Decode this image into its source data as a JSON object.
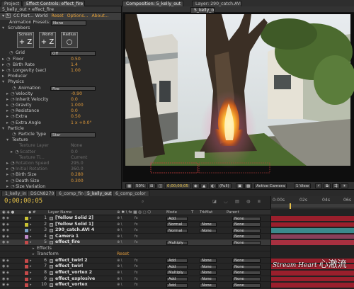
{
  "top_tabs": {
    "project": "Project",
    "effect_controls": "Effect Controls: effect_fire",
    "composition": "Composition: 5_kelly_out",
    "layer": "Layer: 290_catch.AVI 4"
  },
  "effect_controls": {
    "subtitle": "5_kelly_out • effect_fire",
    "effect_name": "CC Part... World",
    "reset": "Reset",
    "options": "Options...",
    "about": "About...",
    "presets_label": "Animation Presets:",
    "presets_value": "None",
    "scrubbers_label": "Scrubbers",
    "scrub": [
      {
        "label": "Screen",
        "glyph": "+ Z"
      },
      {
        "label": "World",
        "glyph": "+ Z"
      },
      {
        "label": "Radius",
        "glyph": "○"
      }
    ],
    "grid_label": "Grid",
    "grid_value": "Off",
    "rows_top": [
      {
        "label": "Floor",
        "value": "0.50"
      },
      {
        "label": "Birth Rate",
        "value": "1.4"
      },
      {
        "label": "Longevity (sec)",
        "value": "1.00"
      }
    ],
    "producer_label": "Producer",
    "physics_label": "Physics",
    "animation_label": "Animation",
    "animation_value": "Fire",
    "physics_rows": [
      {
        "label": "Velocity",
        "value": "-0.90"
      },
      {
        "label": "Inherit Velocity",
        "value": "0.0"
      },
      {
        "label": "Gravity",
        "value": "1.000"
      },
      {
        "label": "Resistance",
        "value": "0.0"
      },
      {
        "label": "Extra",
        "value": "0.50"
      },
      {
        "label": "Extra Angle",
        "value": "1 x +0.0°"
      }
    ],
    "particle_label": "Particle",
    "particle_type_label": "Particle Type",
    "particle_type_value": "Star",
    "texture_label": "Texture",
    "texture_rows": [
      {
        "label": "Texture Layer",
        "value": "None"
      },
      {
        "label": "Scatter",
        "value": "0.0"
      },
      {
        "label": "Texture Ti...",
        "value": "Current"
      }
    ],
    "rotation_rows": [
      {
        "label": "Rotation Speed",
        "value": "295.0"
      },
      {
        "label": "Initial Rotation",
        "value": "360.0"
      }
    ],
    "size_rows": [
      {
        "label": "Birth Size",
        "value": "0.280"
      },
      {
        "label": "Death Size",
        "value": "0.300"
      }
    ],
    "variation_label": "Size Variation"
  },
  "viewer_bar": {
    "zoom": "50%",
    "timecode": "0;00;00;05",
    "resolution": "(Full)",
    "camera": "Active Camera",
    "view": "1 View"
  },
  "timeline_tabs": [
    "1_kelly_in",
    "DSCN8270",
    "6_comp_fin",
    "5_kelly_out",
    "6_comp_color"
  ],
  "timeline": {
    "timecode": "0;00;00;05",
    "ruler": [
      "0:00s",
      "02s",
      "04s",
      "06s"
    ],
    "columns": {
      "layer_name": "Layer Name",
      "mode": "Mode",
      "t": "T",
      "trkmat": "TrkMat",
      "parent": "Parent"
    },
    "layers": [
      {
        "num": "1",
        "name": "[Yellow Solid 2]",
        "mode": "Add",
        "trk": "",
        "parent": "None",
        "color": "#c9c232",
        "bar": "#9a1f2c"
      },
      {
        "num": "2",
        "name": "[Yellow Solid 1]",
        "mode": "Normal",
        "trk": "None",
        "parent": "None",
        "color": "#c9c232",
        "bar": "#9a1f2c"
      },
      {
        "num": "3",
        "name": "290_catch.AVI 4",
        "mode": "Normal",
        "trk": "None",
        "parent": "None",
        "color": "#7aa0c4",
        "bar": "#3b8a8c"
      },
      {
        "num": "4",
        "name": "Camera 1",
        "mode": "",
        "trk": "",
        "parent": "None",
        "color": "#c08ac8",
        "bar": "#8a3f5a"
      },
      {
        "num": "5",
        "name": "effect_fire",
        "mode": "Multiply",
        "trk": "",
        "parent": "None",
        "color": "#c54a4a",
        "bar": "#a83040"
      }
    ],
    "sub_rows": [
      {
        "name": "Effects"
      },
      {
        "name": "Transform",
        "reset": "Reset"
      }
    ],
    "layers_bottom": [
      {
        "num": "6",
        "name": "effect_twirl 2",
        "mode": "Add",
        "trk": "None",
        "parent": "None",
        "color": "#c54a4a",
        "bar": "#9a1f2c"
      },
      {
        "num": "7",
        "name": "effect_twirl",
        "mode": "Add",
        "trk": "None",
        "parent": "None",
        "color": "#c54a4a",
        "bar": "#9a1f2c"
      },
      {
        "num": "8",
        "name": "effect_vortex 2",
        "mode": "Multiply",
        "trk": "None",
        "parent": "None",
        "color": "#c54a4a",
        "bar": "#9a1f2c"
      },
      {
        "num": "9",
        "name": "effect_explosive",
        "mode": "Add",
        "trk": "None",
        "parent": "None",
        "color": "#c54a4a",
        "bar": "#9a1f2c"
      },
      {
        "num": "10",
        "name": "effect_vortex",
        "mode": "Add",
        "trk": "None",
        "parent": "None",
        "color": "#c54a4a",
        "bar": "#9a1f2c"
      }
    ]
  },
  "watermark": {
    "en": "Stream Heart",
    "cn": "心澈流"
  }
}
